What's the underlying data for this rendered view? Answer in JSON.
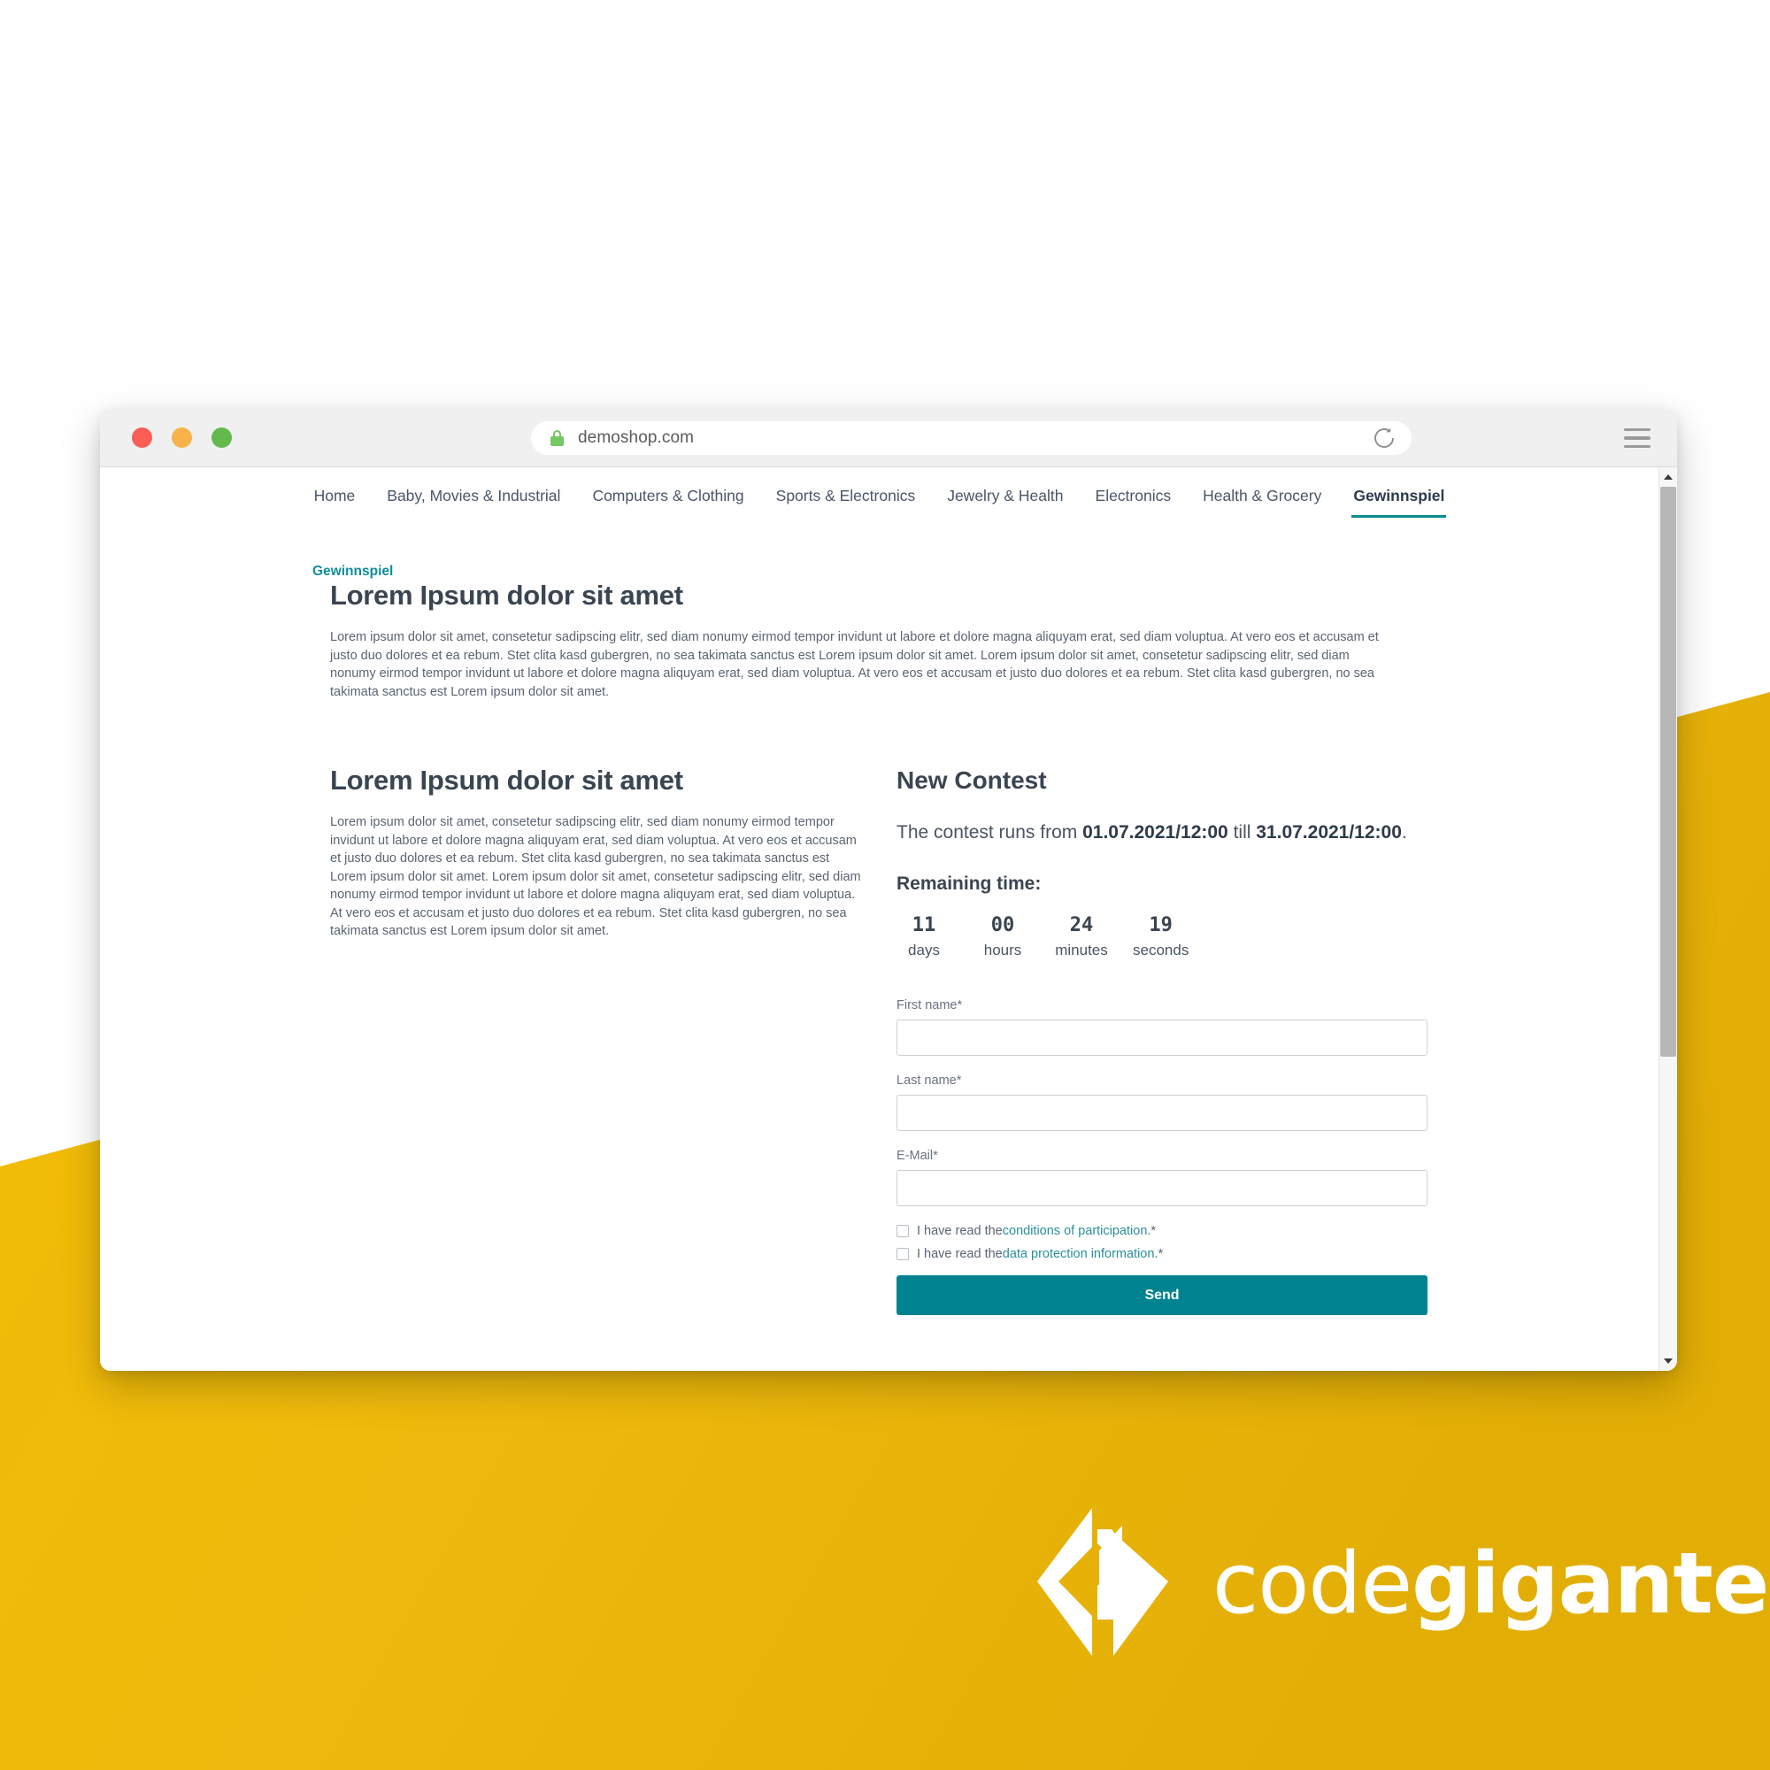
{
  "browser": {
    "traffic_lights": [
      "close",
      "minimize",
      "maximize"
    ],
    "url": "demoshop.com",
    "lock_icon": "lock-icon",
    "reload_icon": "reload-icon",
    "menu_icon": "hamburger-menu-icon",
    "colors": {
      "close": "#fa5e57",
      "minimize": "#f8b24a",
      "maximize": "#63b94b",
      "lock": "#76c663"
    }
  },
  "site_nav": {
    "items": [
      {
        "label": "Home",
        "active": false
      },
      {
        "label": "Baby, Movies & Industrial",
        "active": false
      },
      {
        "label": "Computers & Clothing",
        "active": false
      },
      {
        "label": "Sports & Electronics",
        "active": false
      },
      {
        "label": "Jewelry & Health",
        "active": false
      },
      {
        "label": "Electronics",
        "active": false
      },
      {
        "label": "Health & Grocery",
        "active": false
      },
      {
        "label": "Gewinnspiel",
        "active": true
      }
    ]
  },
  "breadcrumb": {
    "label": "Gewinnspiel"
  },
  "intro": {
    "title": "Lorem Ipsum dolor sit amet",
    "text": "Lorem ipsum dolor sit amet, consetetur sadipscing elitr, sed diam nonumy eirmod tempor invidunt ut labore et dolore magna aliquyam erat, sed diam voluptua. At vero eos et accusam et justo duo dolores et ea rebum. Stet clita kasd gubergren, no sea takimata sanctus est Lorem ipsum dolor sit amet. Lorem ipsum dolor sit amet, consetetur sadipscing elitr, sed diam nonumy eirmod tempor invidunt ut labore et dolore magna aliquyam erat, sed diam voluptua. At vero eos et accusam et justo duo dolores et ea rebum. Stet clita kasd gubergren, no sea takimata sanctus est Lorem ipsum dolor sit amet."
  },
  "left_column": {
    "title": "Lorem Ipsum dolor sit amet",
    "text": "Lorem ipsum dolor sit amet, consetetur sadipscing elitr, sed diam nonumy eirmod tempor invidunt ut labore et dolore magna aliquyam erat, sed diam voluptua. At vero eos et accusam et justo duo dolores et ea rebum. Stet clita kasd gubergren, no sea takimata sanctus est Lorem ipsum dolor sit amet. Lorem ipsum dolor sit amet, consetetur sadipscing elitr, sed diam nonumy eirmod tempor invidunt ut labore et dolore magna aliquyam erat, sed diam voluptua. At vero eos et accusam et justo duo dolores et ea rebum. Stet clita kasd gubergren, no sea takimata sanctus est Lorem ipsum dolor sit amet."
  },
  "contest": {
    "title": "New Contest",
    "runs_prefix": "The contest runs from ",
    "start": "01.07.2021/12:00",
    "runs_middle": " till ",
    "end": "31.07.2021/12:00",
    "runs_suffix": ".",
    "remaining_label": "Remaining time:",
    "countdown": [
      {
        "value": "11",
        "label": "days"
      },
      {
        "value": "00",
        "label": "hours"
      },
      {
        "value": "24",
        "label": "minutes"
      },
      {
        "value": "19",
        "label": "seconds"
      }
    ],
    "form": {
      "fields": [
        {
          "label": "First name*",
          "value": "",
          "placeholder": ""
        },
        {
          "label": "Last name*",
          "value": "",
          "placeholder": ""
        },
        {
          "label": "E-Mail*",
          "value": "",
          "placeholder": ""
        }
      ],
      "checkboxes": [
        {
          "prefix": "I have read the ",
          "link": "conditions of participation",
          "suffix": ".*",
          "checked": false
        },
        {
          "prefix": "I have read the ",
          "link": "data protection information",
          "suffix": ".*",
          "checked": false
        }
      ],
      "submit_label": "Send"
    }
  },
  "brand": {
    "name_light": "code",
    "name_bold": "giganten",
    "logo_icon": "codegiganten-diamond-logo",
    "background_color": "#efb90e",
    "accent_teal": "#00838f"
  }
}
